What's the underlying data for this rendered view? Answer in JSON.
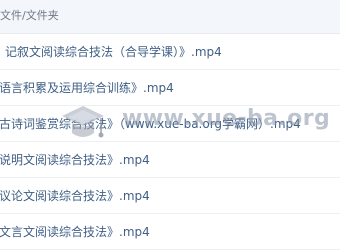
{
  "header": {
    "text": "文件/文件夹"
  },
  "rows": [
    {
      "name": "记叙文阅读综合技法（合导学课）》.mp4"
    },
    {
      "name": "语言积累及运用综合训练》.mp4"
    },
    {
      "name": "古诗词鉴赏综合技法》（www.xue-ba.org学霸网）.mp4"
    },
    {
      "name": "说明文阅读综合技法》.mp4"
    },
    {
      "name": "议论文阅读综合技法》.mp4"
    },
    {
      "name": "文言文阅读综合技法》.mp4"
    }
  ],
  "watermark": {
    "text": "www.xue-ba.org",
    "icon": "graduation-cap-icon"
  }
}
